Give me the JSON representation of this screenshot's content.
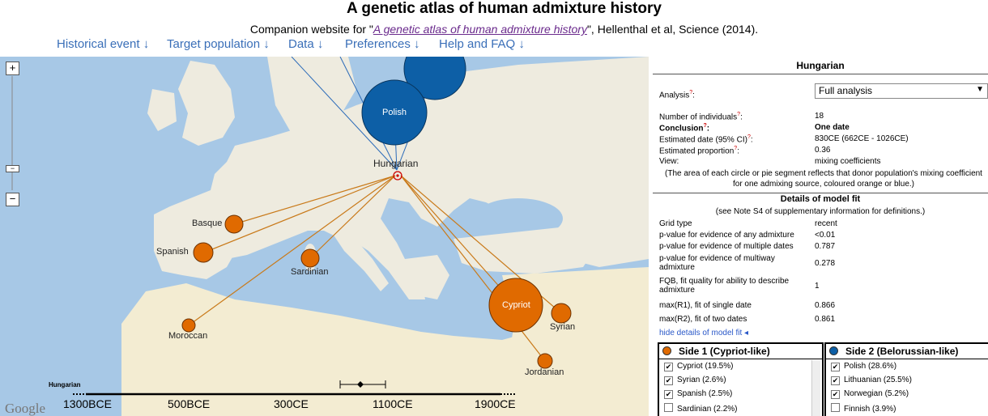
{
  "header": {
    "title": "A genetic atlas of human admixture history",
    "subtitle_pre": "Companion website for \"",
    "subtitle_link": "A genetic atlas of human admixture history",
    "subtitle_post": "\", Hellenthal et al, Science (2014)."
  },
  "nav": [
    "Historical event ↓",
    "Target population ↓",
    "Data ↓",
    "Preferences ↓",
    "Help and FAQ ↓"
  ],
  "map": {
    "zoom_in": "+",
    "zoom_out": "−",
    "target_label": "Hungarian",
    "populations": [
      {
        "name": "Polish",
        "side": 2
      },
      {
        "name": "Lithuanian",
        "side": 2
      },
      {
        "name": "Basque",
        "side": 1
      },
      {
        "name": "Spanish",
        "side": 1
      },
      {
        "name": "Sardinian",
        "side": 1
      },
      {
        "name": "Moroccan",
        "side": 1
      },
      {
        "name": "Cypriot",
        "side": 1
      },
      {
        "name": "Syrian",
        "side": 1
      },
      {
        "name": "Jordanian",
        "side": 1
      }
    ],
    "timeline": {
      "label": "Hungarian",
      "ticks": [
        "1300BCE",
        "500BCE",
        "300CE",
        "1100CE",
        "1900CE"
      ]
    },
    "logo": "Google",
    "colors": {
      "side1": "#e06a00",
      "side2": "#0d5fa6",
      "sea": "#a7c8e6",
      "land": "#f2efe6"
    }
  },
  "panel": {
    "title": "Hungarian",
    "analysis_label": "Analysis",
    "analysis_value": "Full analysis",
    "rows": [
      {
        "k": "Number of individuals",
        "v": "18"
      },
      {
        "k": "Conclusion",
        "v": "One date"
      },
      {
        "k": "Estimated date (95% CI)",
        "v": "830CE (662CE - 1026CE)"
      },
      {
        "k": "Estimated proportion",
        "v": "0.36"
      },
      {
        "k": "View:",
        "v": "mixing coefficients"
      }
    ],
    "note": "(The area of each circle or pie segment reflects that donor population's mixing coefficient for one admixing source, coloured orange or blue.)",
    "fit_title": "Details of model fit",
    "fit_note": "(see Note S4 of supplementary information for definitions.)",
    "fit_rows": [
      {
        "k": "Grid type",
        "v": "recent"
      },
      {
        "k": "p-value for evidence of any admixture",
        "v": "<0.01"
      },
      {
        "k": "p-value for evidence of multiple dates",
        "v": "0.787"
      },
      {
        "k": "p-value for evidence of multiway admixture",
        "v": "0.278"
      },
      {
        "k": "FQB, fit quality for ability to describe admixture",
        "v": "1"
      },
      {
        "k": "max(R1), fit of single date",
        "v": "0.866"
      },
      {
        "k": "max(R2), fit of two dates",
        "v": "0.861"
      }
    ],
    "hide_link": "hide details of model fit ◂",
    "side1": {
      "title": "Side 1 (Cypriot-like)",
      "items": [
        {
          "label": "Cypriot (19.5%)",
          "checked": true
        },
        {
          "label": "Syrian (2.6%)",
          "checked": true
        },
        {
          "label": "Spanish (2.5%)",
          "checked": true
        },
        {
          "label": "Sardinian (2.2%)",
          "checked": false
        }
      ]
    },
    "side2": {
      "title": "Side 2 (Belorussian-like)",
      "items": [
        {
          "label": "Polish (28.6%)",
          "checked": true
        },
        {
          "label": "Lithuanian (25.5%)",
          "checked": true
        },
        {
          "label": "Norwegian (5.2%)",
          "checked": true
        },
        {
          "label": "Finnish (3.9%)",
          "checked": false
        }
      ]
    }
  }
}
